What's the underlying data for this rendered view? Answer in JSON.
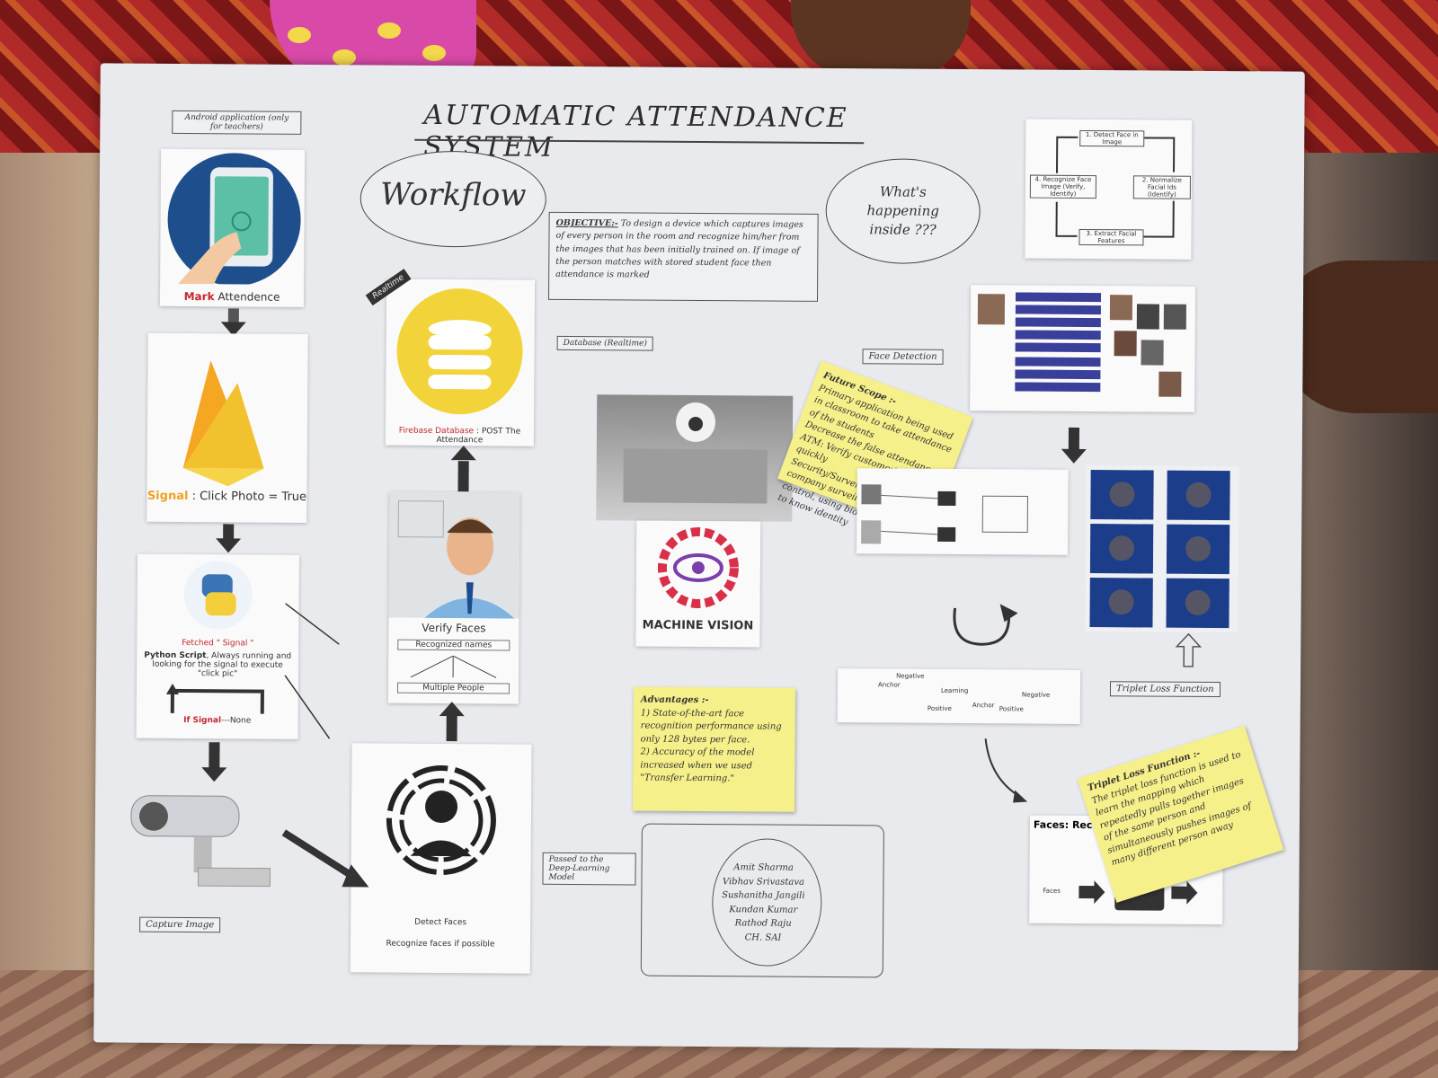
{
  "poster": {
    "title": "AUTOMATIC ATTENDANCE SYSTEM",
    "workflow_label": "Workflow",
    "whats_happening": "What's happening inside ???",
    "objective": {
      "label": "OBJECTIVE:-",
      "text": "To design a device which captures images of every person in the room and recognize him/her from the images that has been initially trained on. If image of the person matches with stored student face then attendance is marked"
    },
    "android": {
      "note": "Android application (only for teachers)",
      "caption_strong": "Mark",
      "caption_rest": " Attendence"
    },
    "firebase_signal": {
      "caption_strong": "Signal",
      "caption_rest": " : Click Photo = True"
    },
    "python": {
      "fetched": "Fetched \" Signal \"",
      "desc_strong": "Python Script",
      "desc_rest": ", Always running and looking for the signal to execute \"click pic\"",
      "loop_strong": "If Signal",
      "loop_rest": "---None"
    },
    "capture_label": "Capture Image",
    "database": {
      "tag": "Realtime",
      "caption_strong": "Firebase Database",
      "caption_rest": " : POST The Attendance",
      "side_label": "Database (Realtime)"
    },
    "verify": {
      "title": "Verify Faces",
      "recognized": "Recognized names",
      "multiple": "Multiple People"
    },
    "detect": {
      "line1": "Detect Faces",
      "line2": "Recognize faces if possible"
    },
    "passed_label": "Passed to the Deep-Learning Model",
    "machine_vision": "MACHINE VISION",
    "face_detection_label": "Face Detection",
    "cycle": {
      "step1": "1. Detect Face in Image",
      "step2": "2. Normalize Facial Ids (Identify)",
      "step3": "3. Extract Facial Features",
      "step4": "4. Recognize Face Image (Verify, Identify)"
    },
    "future_scope": {
      "label": "Future Scope :-",
      "lines": [
        "Primary application being used in classroom to take attendance of the students",
        "Decrease the false attendance",
        "ATM: Verify customer's face quickly",
        "Security/Surveillance : company surveillance access control, using biometric images to know identity"
      ]
    },
    "advantages": {
      "label": "Advantages :-",
      "lines": [
        "1) State-of-the-art face recognition performance using only 128 bytes per face.",
        "2) Accuracy of the model increased when we used \"Transfer Learning.\""
      ]
    },
    "triplet_label": "Triplet Loss Function",
    "triplet_note": {
      "label": "Triplet Loss Function :-",
      "text": "The triplet loss function is used to learn the mapping which repeatedly pulls together images of the same person and simultaneously pushes images of many different person away"
    },
    "triplet_diagram": {
      "anchor": "Anchor",
      "negative": "Negative",
      "positive": "Positive",
      "learning": "Learning"
    },
    "faces_recog": "Faces: Recogn",
    "faces_in": "Faces",
    "team": [
      "Amit Sharma",
      "Vibhav Srivastava",
      "Sushanitha Jangili",
      "Kundan Kumar",
      "Rathod Raju",
      "CH. SAI"
    ]
  },
  "colors": {
    "poster": "#e9eaee",
    "sticky": "#f6f08a",
    "firebase": "#f2c12e",
    "db": "#f2d43a",
    "vision": "#d9304a"
  }
}
